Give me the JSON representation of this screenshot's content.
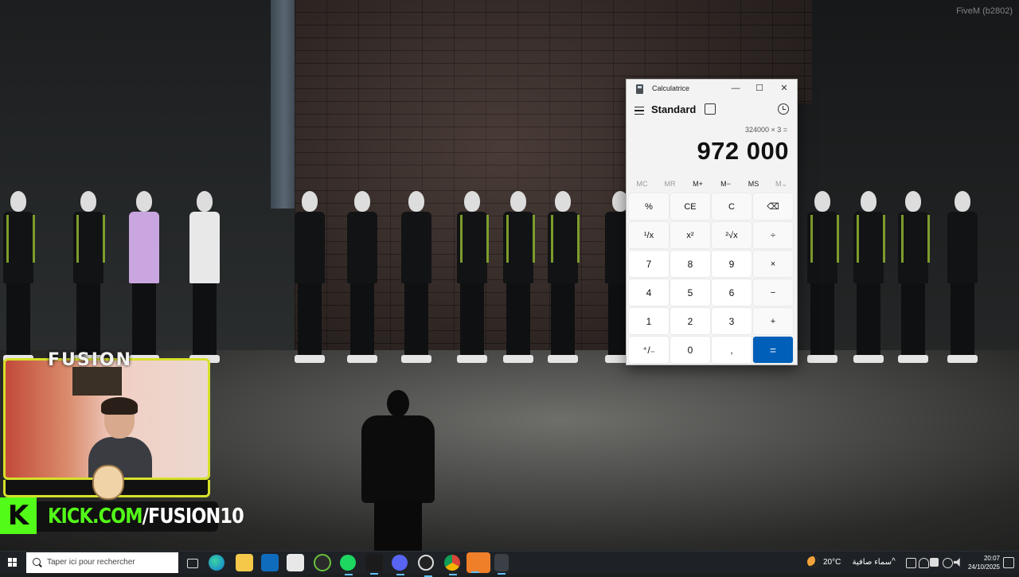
{
  "game": {
    "watermark": "FiveM (b2802)"
  },
  "calculator": {
    "window_title": "Calculatrice",
    "window_controls": {
      "minimize": "—",
      "maximize": "☐",
      "close": "✕"
    },
    "mode": "Standard",
    "expression": "324000 × 3 =",
    "result": "972 000",
    "memory_keys": [
      {
        "label": "MC",
        "enabled": false
      },
      {
        "label": "MR",
        "enabled": false
      },
      {
        "label": "M+",
        "enabled": true
      },
      {
        "label": "M−",
        "enabled": true
      },
      {
        "label": "MS",
        "enabled": true
      },
      {
        "label": "M⌄",
        "enabled": false
      }
    ],
    "keys": [
      {
        "label": "%",
        "type": "op",
        "name": "percent-key"
      },
      {
        "label": "CE",
        "type": "op",
        "name": "clear-entry-key"
      },
      {
        "label": "C",
        "type": "op",
        "name": "clear-key"
      },
      {
        "label": "⌫",
        "type": "op",
        "name": "backspace-key"
      },
      {
        "label": "¹/x",
        "type": "op",
        "name": "reciprocal-key"
      },
      {
        "label": "x²",
        "type": "op",
        "name": "square-key"
      },
      {
        "label": "²√x",
        "type": "op",
        "name": "square-root-key"
      },
      {
        "label": "÷",
        "type": "op",
        "name": "divide-key"
      },
      {
        "label": "7",
        "type": "num",
        "name": "digit-7-key"
      },
      {
        "label": "8",
        "type": "num",
        "name": "digit-8-key"
      },
      {
        "label": "9",
        "type": "num",
        "name": "digit-9-key"
      },
      {
        "label": "×",
        "type": "op",
        "name": "multiply-key"
      },
      {
        "label": "4",
        "type": "num",
        "name": "digit-4-key"
      },
      {
        "label": "5",
        "type": "num",
        "name": "digit-5-key"
      },
      {
        "label": "6",
        "type": "num",
        "name": "digit-6-key"
      },
      {
        "label": "−",
        "type": "op",
        "name": "subtract-key"
      },
      {
        "label": "1",
        "type": "num",
        "name": "digit-1-key"
      },
      {
        "label": "2",
        "type": "num",
        "name": "digit-2-key"
      },
      {
        "label": "3",
        "type": "num",
        "name": "digit-3-key"
      },
      {
        "label": "+",
        "type": "op",
        "name": "add-key"
      },
      {
        "label": "⁺/₋",
        "type": "num",
        "name": "negate-key"
      },
      {
        "label": "0",
        "type": "num",
        "name": "digit-0-key"
      },
      {
        "label": ",",
        "type": "num",
        "name": "decimal-key"
      },
      {
        "label": "=",
        "type": "equals",
        "name": "equals-key"
      }
    ],
    "accent_color": "#005fb8"
  },
  "stream_overlay": {
    "brand": "FUSION",
    "kick_domain": "KICK.COM",
    "kick_slash": "/",
    "kick_channel": "FUSION10",
    "kick_color": "#53fc18",
    "frame_color": "#d6e02a"
  },
  "taskbar": {
    "search_placeholder": "Taper ici pour rechercher",
    "pinned_icons": [
      "taskview-icon",
      "edge-icon",
      "file-explorer-icon",
      "outlook-icon",
      "store-icon",
      "xbox-icon",
      "spotify-icon",
      "kick-icon",
      "discord-icon",
      "obs-icon",
      "chrome-icon",
      "fivem-icon",
      "calculator-icon"
    ],
    "weather_temp": "20°C",
    "weather_desc": "سماء صافية",
    "time": "20:07",
    "date": "24/10/2025"
  }
}
